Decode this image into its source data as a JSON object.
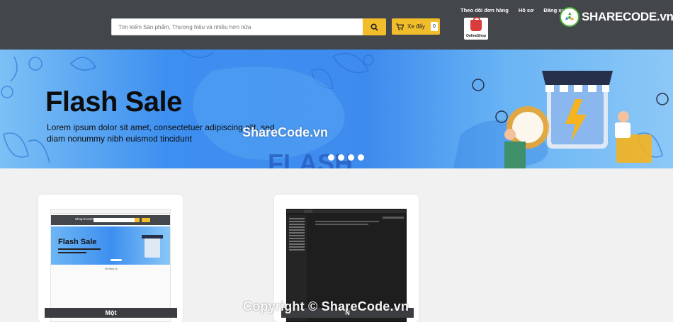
{
  "header": {
    "top_links": [
      "Theo dõi đơn hàng",
      "Hồ sơ",
      "Đăng xuất"
    ],
    "search_placeholder": "Tìm kiếm Sản phẩm, Thương hiệu và nhiều hơn nữa",
    "cart_label": "Xe đẩy",
    "cart_count": "0",
    "shop_logo_text": "OnlineShop",
    "brand_text": "SHARECODE.vn",
    "colors": {
      "header_bg": "#43464b",
      "accent": "#f2bd2b"
    }
  },
  "banner": {
    "title": "Flash Sale",
    "subtitle": "Lorem ipsum dolor sit amet, consectetuer adipiscing elit, sed diam nonummy nibh euismod tincidunt",
    "watermark": "ShareCode.vn",
    "flash_text": "FLASH",
    "dot_count": 4
  },
  "cards": [
    {
      "label": "Một",
      "thumbnail": {
        "header_text": "Shop Ecommerce",
        "banner_title": "Flash Sale",
        "caption": "Đã đăng ký"
      }
    },
    {
      "label": "N",
      "thumbnail": {}
    }
  ],
  "footer": {
    "copyright": "Copyright © ShareCode.vn"
  }
}
